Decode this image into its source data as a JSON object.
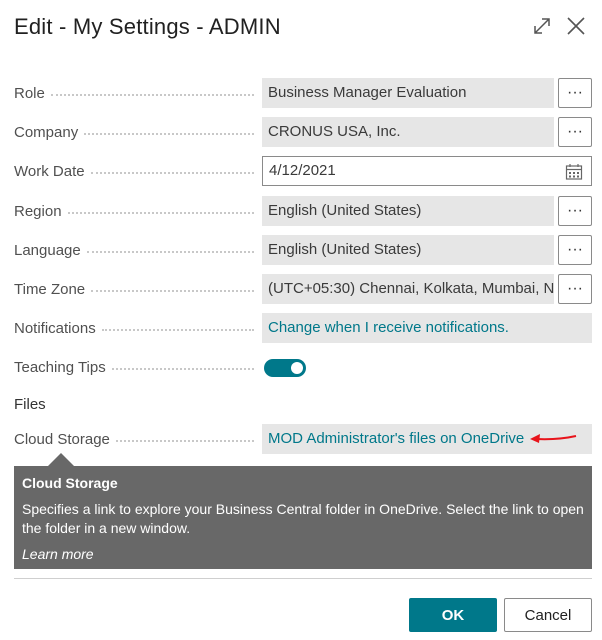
{
  "dialog": {
    "title": "Edit - My Settings - ADMIN",
    "expand_icon": "expand-icon",
    "close_icon": "close-icon"
  },
  "fields": [
    {
      "label": "Role",
      "value": "Business Manager Evaluation",
      "has_lookup": true,
      "lookup_label": "···"
    },
    {
      "label": "Company",
      "value": "CRONUS USA, Inc.",
      "has_lookup": true,
      "lookup_label": "···"
    },
    {
      "label": "Work Date",
      "value": "4/12/2021",
      "icon": "calendar-icon"
    },
    {
      "label": "Region",
      "value": "English (United States)",
      "has_lookup": true,
      "lookup_label": "···"
    },
    {
      "label": "Language",
      "value": "English (United States)",
      "has_lookup": true,
      "lookup_label": "···"
    },
    {
      "label": "Time Zone",
      "value": "(UTC+05:30) Chennai, Kolkata, Mumbai, N...",
      "has_lookup": true,
      "lookup_label": "···"
    },
    {
      "label": "Notifications",
      "value": "Change when I receive notifications."
    },
    {
      "label": "Teaching Tips",
      "toggle_on": true
    }
  ],
  "files_section": {
    "heading": "Files",
    "cloud_storage_label": "Cloud Storage",
    "cloud_storage_value": "MOD Administrator's files on OneDrive"
  },
  "tooltip": {
    "title": "Cloud Storage",
    "body": "Specifies a link to explore your Business Central folder in OneDrive. Select the link to open the folder in a new window.",
    "learn_more": "Learn more"
  },
  "footer": {
    "ok_label": "OK",
    "cancel_label": "Cancel"
  },
  "colors": {
    "accent": "#00788a",
    "tooltip_bg": "#686868",
    "annotation_arrow": "#e8141b"
  }
}
